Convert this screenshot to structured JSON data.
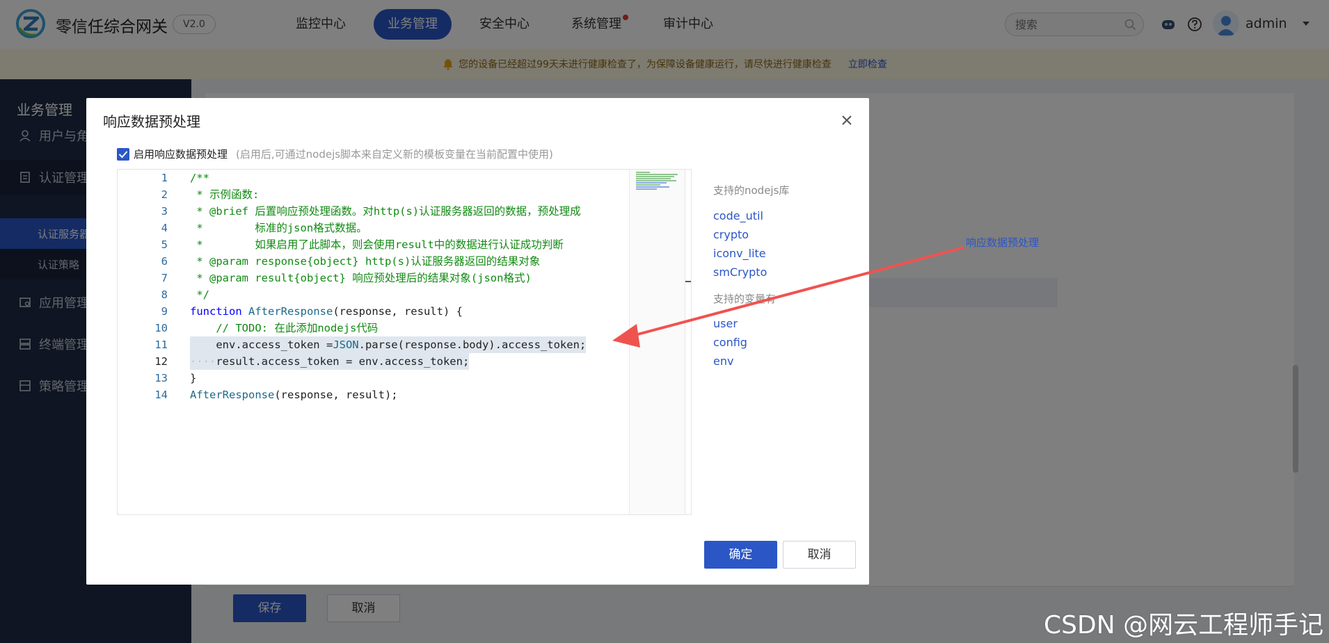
{
  "app": {
    "brand": "零信任综合网关",
    "version": "V2.0"
  },
  "nav": {
    "items": [
      "监控中心",
      "业务管理",
      "安全中心",
      "系统管理",
      "审计中心"
    ],
    "active": "业务管理"
  },
  "search": {
    "placeholder": "搜索"
  },
  "user": {
    "name": "admin"
  },
  "notice": {
    "text": "您的设备已经超过99天未进行健康检查了，为保障设备健康运行，请尽快进行健康检查",
    "link": "立即检查"
  },
  "sidebar": {
    "title": "业务管理",
    "items": [
      "用户与角",
      "认证管理",
      "应用管理",
      "终端管理",
      "策略管理"
    ],
    "subitems": [
      "认证服务器",
      "认证策略"
    ]
  },
  "background": {
    "annotation_link": "响应数据预处理",
    "save": "保存",
    "cancel": "取消"
  },
  "modal": {
    "title": "响应数据预处理",
    "enable_label": "启用响应数据预处理",
    "enable_hint": "(启用后,可通过nodejs脚本来自定义新的模板变量在当前配置中使用)",
    "libs_title": "支持的nodejs库",
    "libs": [
      "code_util",
      "crypto",
      "iconv_lite",
      "smCrypto"
    ],
    "vars_title": "支持的变量有",
    "vars": [
      "user",
      "config",
      "env"
    ],
    "ok": "确定",
    "cancel": "取消"
  },
  "code": {
    "lines": [
      "1",
      "2",
      "3",
      "4",
      "5",
      "6",
      "7",
      "8",
      "9",
      "10",
      "11",
      "12",
      "13",
      "14"
    ],
    "l1": "/**",
    "l2": " * 示例函数:",
    "l3": " * @brief 后置响应预处理函数。对http(s)认证服务器返回的数据，预处理成",
    "l4": " *        标准的json格式数据。",
    "l5": " *        如果启用了此脚本，则会使用result中的数据进行认证成功判断",
    "l6": " * @param response{object} http(s)认证服务器返回的结果对象",
    "l7": " * @param result{object} 响应预处理后的结果对象(json格式)",
    "l8": " */",
    "l9_kw": "function",
    "l9_fn": "AfterResponse",
    "l9_rest": "(response, result) {",
    "l10": "    // TODO: 在此添加nodejs代码",
    "l11_a": "    env.access_token ",
    "l11_b": "=",
    "l11_c": "JSON",
    "l11_d": ".parse(response.body).access_token;",
    "l12_ws": "····",
    "l12_a": "result.access_token ",
    "l12_b": "= ",
    "l12_c": "env.access_token;",
    "l13": "}",
    "l14_fn": "AfterResponse",
    "l14_rest": "(response, result);"
  },
  "watermark": "CSDN @网云工程师手记",
  "colors": {
    "primary": "#2b56c6",
    "sidebar": "#1f2a44",
    "arrow": "#ef5350",
    "comment": "#118a12"
  }
}
